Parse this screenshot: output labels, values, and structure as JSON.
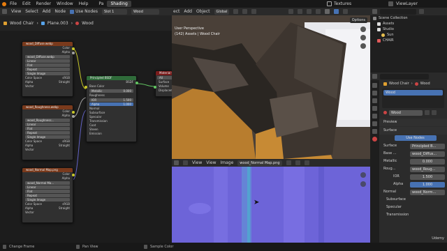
{
  "topbar": {
    "menu": [
      "File",
      "Edit",
      "Render",
      "Window",
      "Help"
    ],
    "tabs": [
      "Pa",
      "Shading"
    ],
    "active_tab": "Shading",
    "scene_label": "Textures",
    "view_layer": "ViewLayer"
  },
  "node_editor": {
    "header": {
      "view": "View",
      "select": "Select",
      "add": "Add",
      "node": "Node",
      "use_nodes": "Use Nodes",
      "slot": "Slot 1",
      "material": "Wood"
    },
    "breadcrumb": [
      "Wood Chair",
      "Plane.003",
      "Wood"
    ],
    "nodes": {
      "tex1": {
        "title": "wood_Diffuse.webp",
        "image": "wood_Diffuse.webp",
        "interp": "Linear",
        "proj": "Flat",
        "ext": "Repeat",
        "source": "Single Image",
        "cs_label": "Color Space",
        "cs": "sRGB",
        "alpha_label": "Alpha",
        "alpha": "Straight",
        "vector": "Vector",
        "out_color": "Color",
        "out_alpha": "Alpha"
      },
      "tex2": {
        "title": "wood_Roughness.webp",
        "image": "wood_Roughness...",
        "interp": "Linear",
        "proj": "Flat",
        "ext": "Repeat",
        "source": "Single Image",
        "cs_label": "Color Space",
        "cs": "sRGB",
        "alpha_label": "Alpha",
        "alpha": "Straight",
        "vector": "Vector",
        "out_color": "Color",
        "out_alpha": "Alpha"
      },
      "tex3": {
        "title": "wood_Normal Map.png",
        "image": "wood_Normal Ma...",
        "interp": "Linear",
        "proj": "Flat",
        "ext": "Repeat",
        "source": "Single Image",
        "cs_label": "Color Space",
        "cs": "sRGB",
        "alpha_label": "Alpha",
        "alpha": "Straight",
        "vector": "Vector",
        "out_color": "Color",
        "out_alpha": "Alpha"
      },
      "bsdf": {
        "title": "Principled BSDF",
        "out": "BSDF",
        "rows": [
          "Base Color",
          "Metallic",
          "Roughness",
          "IOR",
          "Alpha",
          "Normal",
          "Subsurface",
          "Specular",
          "Transmission",
          "Coat",
          "Sheen",
          "Emission"
        ],
        "metallic": "0.000",
        "ior": "1.500",
        "alpha": "1.000"
      },
      "output": {
        "title": "Material Ou...",
        "target": "All",
        "rows": [
          "Surface",
          "Volume",
          "Displacement"
        ]
      }
    }
  },
  "viewport": {
    "header": {
      "select": "ect",
      "add": "Add",
      "object": "Object",
      "orientation": "Global",
      "options": "Options"
    },
    "info_line1": "User Perspective",
    "info_line2": "(142) Assets | Wood Chair"
  },
  "image_editor": {
    "header": {
      "view": "View",
      "view2": "View",
      "image": "Image",
      "image_name": "wood_Normal Map.png"
    }
  },
  "outliner": {
    "title": "Scene Collection",
    "items": [
      "Assets",
      "Studio",
      "Sun",
      "CHAIR"
    ]
  },
  "properties": {
    "object": "Wood Chair",
    "material_field": "Wood",
    "slot": "Wood",
    "material_name": "Wood",
    "preview_label": "Preview",
    "surface_label": "Surface",
    "use_nodes": "Use Nodes",
    "rows": [
      {
        "label": "Surface",
        "value": "Principled B..."
      },
      {
        "label": "Base ...",
        "value": "wood_Diffus..."
      },
      {
        "label": "Metallic",
        "value": "0.000"
      },
      {
        "label": "Roug...",
        "value": "wood_Roug..."
      },
      {
        "label": "IOR",
        "value": "1.500"
      },
      {
        "label": "Alpha",
        "value": "1.000"
      },
      {
        "label": "Normal",
        "value": "wood_Norm..."
      }
    ],
    "sections": [
      "Subsurface",
      "Specular",
      "Transmission"
    ]
  },
  "status": {
    "left": "Change Frame",
    "mid": "Pan View",
    "right": "Sample Color"
  },
  "watermark": "Udemy",
  "colors": {
    "accent": "#4772b3",
    "tex_header": "#7a3a1c",
    "shader_header": "#2f6b3a",
    "output_header": "#7a1c1c",
    "active_tab": "#3c3c3c"
  },
  "icons": [
    "editor-type-icon",
    "eye-icon",
    "camera-icon",
    "render-icon",
    "material-icon",
    "cursor-icon",
    "zoom-icon",
    "hand-icon",
    "shield-icon",
    "folder-icon",
    "light-icon",
    "collection-icon"
  ]
}
